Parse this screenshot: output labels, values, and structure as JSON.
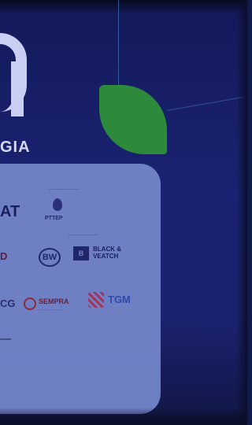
{
  "scene": {
    "subtitle": "GIA",
    "logos": {
      "at_fragment": "AT",
      "d_fragment": "D",
      "cg_fragment": "CG",
      "pttep": "PTTEP",
      "bw": "BW",
      "black_veatch_mark": "B",
      "black_veatch": "BLACK & VEATCH",
      "sempra": "SEMPRA",
      "tgm": "TGM"
    },
    "colors": {
      "background": "#1a2372",
      "panel": "#7183c8",
      "leaf": "#2c8a3a",
      "letter": "#c8cff2"
    }
  }
}
